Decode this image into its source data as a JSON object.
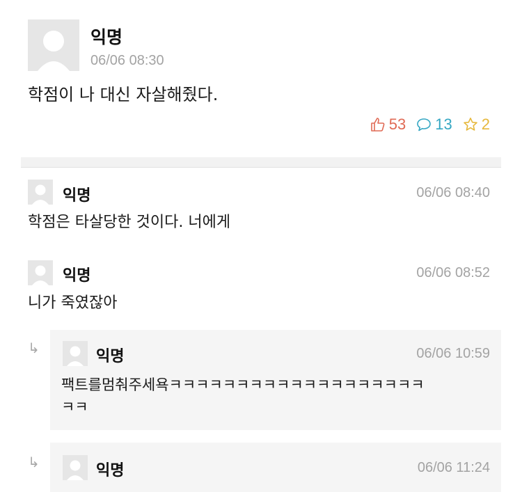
{
  "post": {
    "author": "익명",
    "time": "06/06 08:30",
    "body": "학점이 나 대신 자살해줬다.",
    "likes": "53",
    "comments": "13",
    "scraps": "2"
  },
  "comments": [
    {
      "author": "익명",
      "time": "06/06 08:40",
      "body": "학점은 타살당한 것이다. 너에게"
    },
    {
      "author": "익명",
      "time": "06/06 08:52",
      "body": "니가 죽였잖아"
    }
  ],
  "replies": [
    {
      "author": "익명",
      "time": "06/06 10:59",
      "body_line1": "팩트를멈춰주세욕ㅋㅋㅋㅋㅋㅋㅋㅋㅋㅋㅋㅋㅋㅋㅋㅋㅋㅋㅋ",
      "body_line2": "ㅋㅋ"
    },
    {
      "author": "익명",
      "time": "06/06 11:24"
    }
  ],
  "reply_arrow": "↳",
  "colors": {
    "like": "#e06a55",
    "comment": "#35a7c3",
    "scrap": "#e6b83c",
    "meta": "#a3a3a3"
  }
}
